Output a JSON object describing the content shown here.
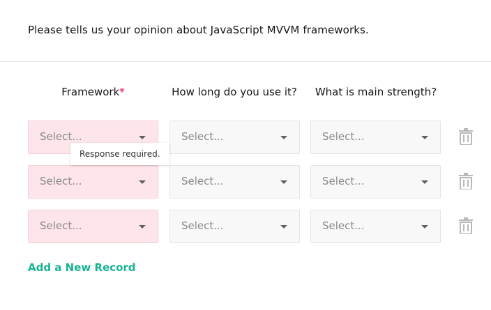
{
  "question": {
    "title": "Please tells us your opinion about JavaScript MVVM frameworks."
  },
  "columns": [
    {
      "label": "Framework",
      "required": "*"
    },
    {
      "label": "How long do you use it?"
    },
    {
      "label": "What is main strength?"
    }
  ],
  "rows": [
    {
      "cells": [
        "Select...",
        "Select...",
        "Select..."
      ]
    },
    {
      "cells": [
        "Select...",
        "Select...",
        "Select..."
      ]
    },
    {
      "cells": [
        "Select...",
        "Select...",
        "Select..."
      ]
    }
  ],
  "error": {
    "message": "Response required."
  },
  "add_record_label": "Add a New Record",
  "colors": {
    "accent": "#19b394",
    "required_star": "#e50a3e",
    "error_bg": "#fde5ea",
    "select_bg": "#f8f8f8"
  },
  "icons": {
    "remove_row": "trash-icon",
    "dropdown": "chevron-down-icon"
  }
}
